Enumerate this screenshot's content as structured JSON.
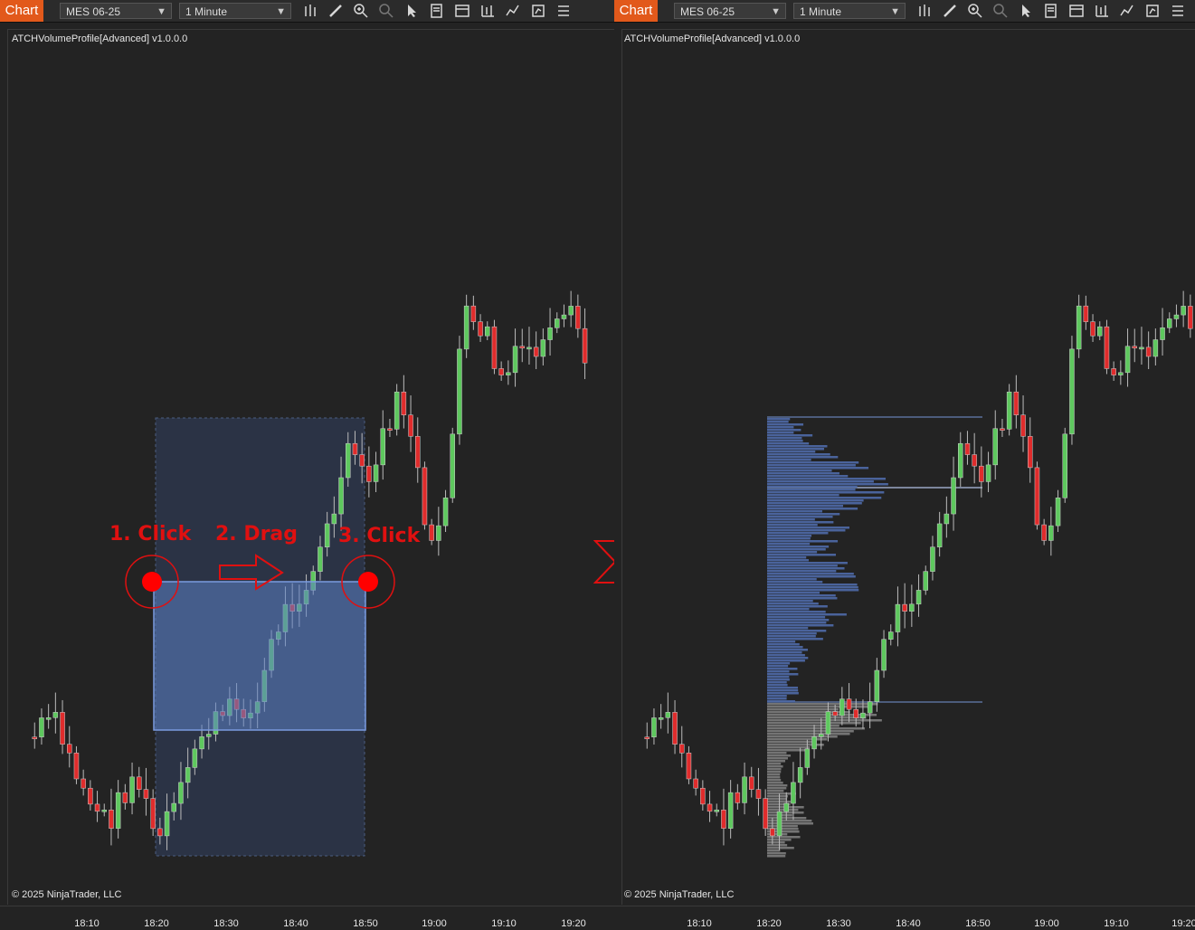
{
  "left_panel": {
    "tab": "Chart",
    "instrument": "MES 06-25",
    "interval": "1 Minute",
    "indicator_label": "ATCHVolumeProfile[Advanced] v1.0.0.0",
    "copyright": "© 2025 NinjaTrader, LLC",
    "x_ticks": [
      "18:10",
      "18:20",
      "18:30",
      "18:40",
      "18:50",
      "19:00",
      "19:10",
      "19:20"
    ],
    "steps": {
      "step1": "1. Click",
      "step2": "2. Drag",
      "step3": "3. Click"
    }
  },
  "right_panel": {
    "tab": "Chart",
    "instrument": "MES 06-25",
    "interval": "1 Minute",
    "indicator_label": "ATCHVolumeProfile[Advanced] v1.0.0.0",
    "copyright": "© 2025 NinjaTrader, LLC",
    "x_ticks": [
      "18:10",
      "18:20",
      "18:30",
      "18:40",
      "18:50",
      "19:00",
      "19:10",
      "19:20"
    ]
  },
  "toolbar_icons": [
    "bars-icon",
    "pencil-icon",
    "zoom-in-icon",
    "zoom-out-icon",
    "pointer-icon",
    "properties-icon",
    "template-icon",
    "strategies-icon",
    "indicators-icon",
    "share-icon",
    "menu-icon"
  ],
  "colors": {
    "up": "#5ec85e",
    "down": "#e02c2c",
    "tab": "#e2591b",
    "selection": "#5b7fc4",
    "profile": "#4f6aa8",
    "annotation": "#e01010"
  }
}
